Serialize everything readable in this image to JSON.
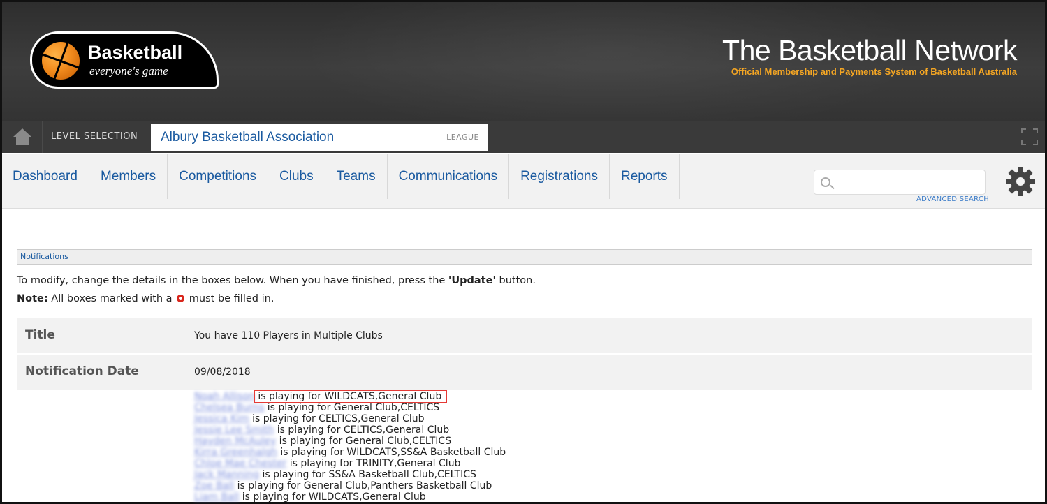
{
  "header": {
    "logo_title": "Basketball",
    "logo_sub": "everyone's game",
    "site_title": "The Basketball Network",
    "site_sub_prefix": "Official Membership and Payments System of",
    "site_sub_org": "Basketball Australia"
  },
  "levelbar": {
    "label": "LEVEL SELECTION",
    "selected_name": "Albury Basketball Association",
    "selected_type": "LEAGUE"
  },
  "nav": {
    "items": [
      "Dashboard",
      "Members",
      "Competitions",
      "Clubs",
      "Teams",
      "Communications",
      "Registrations",
      "Reports"
    ],
    "search_placeholder": "",
    "advanced_search": "ADVANCED SEARCH"
  },
  "content": {
    "breadcrumb": "Notifications",
    "instr_prefix": "To modify, change the details in the boxes below. When you have finished, press the ",
    "instr_button": "'Update'",
    "instr_suffix": " button.",
    "note_label": "Note:",
    "note_prefix": " All boxes marked with a ",
    "note_suffix": " must be filled in.",
    "title_label": "Title",
    "title_value": "You have 110 Players in Multiple Clubs",
    "date_label": "Notification Date",
    "date_value": "09/08/2018"
  },
  "players": [
    {
      "name": "Noah Allison",
      "text": " is playing for WILDCATS,General Club"
    },
    {
      "name": "Chelsea Burns",
      "text": " is playing for General Club,CELTICS"
    },
    {
      "name": "Jessica Kim",
      "text": " is playing for CELTICS,General Club"
    },
    {
      "name": "Jessie Lee Smith",
      "text": " is playing for CELTICS,General Club"
    },
    {
      "name": "Hayden McAuley",
      "text": " is playing for General Club,CELTICS"
    },
    {
      "name": "Kirra Greenhalgh",
      "text": " is playing for WILDCATS,SS&A Basketball Club"
    },
    {
      "name": "Chloe Mae Chester",
      "text": " is playing for TRINITY,General Club"
    },
    {
      "name": "Jack Manning",
      "text": " is playing for SS&A Basketball Club,CELTICS"
    },
    {
      "name": "Zoe Ball",
      "text": " is playing for General Club,Panthers Basketball Club"
    },
    {
      "name": "Liam Ball",
      "text": " is playing for WILDCATS,General Club"
    }
  ]
}
